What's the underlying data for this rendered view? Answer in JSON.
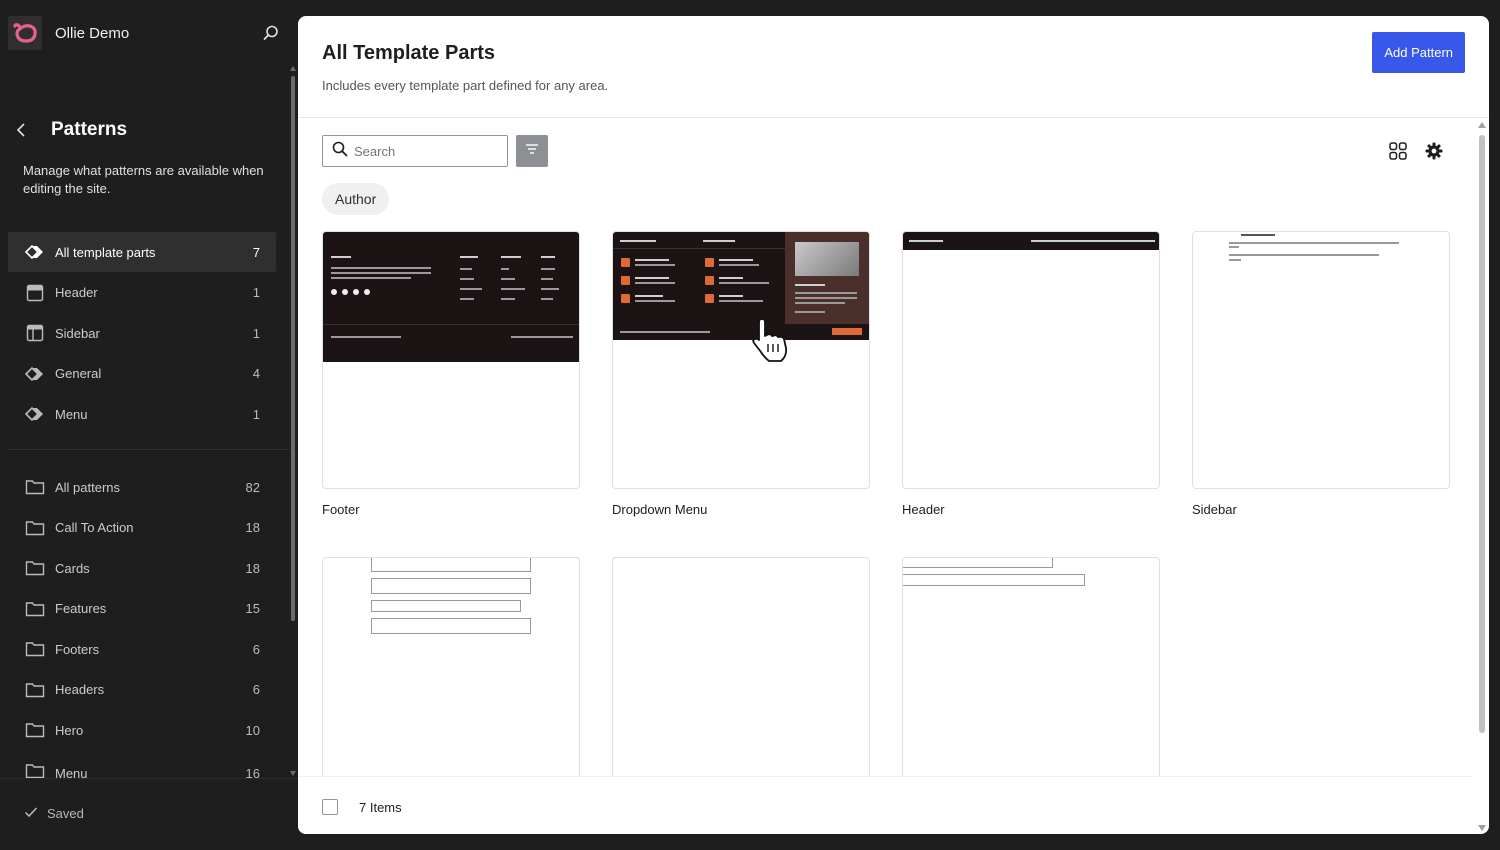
{
  "site": {
    "title": "Ollie Demo"
  },
  "nav": {
    "title": "Patterns",
    "description": "Manage what patterns are available when editing the site."
  },
  "template_parts": [
    {
      "label": "All template parts",
      "count": "7",
      "icon": "diamond-icon"
    },
    {
      "label": "Header",
      "count": "1",
      "icon": "header-layout-icon"
    },
    {
      "label": "Sidebar",
      "count": "1",
      "icon": "sidebar-layout-icon"
    },
    {
      "label": "General",
      "count": "4",
      "icon": "diamond-icon"
    },
    {
      "label": "Menu",
      "count": "1",
      "icon": "diamond-icon"
    }
  ],
  "categories": [
    {
      "label": "All patterns",
      "count": "82"
    },
    {
      "label": "Call To Action",
      "count": "18"
    },
    {
      "label": "Cards",
      "count": "18"
    },
    {
      "label": "Features",
      "count": "15"
    },
    {
      "label": "Footers",
      "count": "6"
    },
    {
      "label": "Headers",
      "count": "6"
    },
    {
      "label": "Hero",
      "count": "10"
    },
    {
      "label": "Menu",
      "count": "16"
    }
  ],
  "status": {
    "saved": "Saved"
  },
  "main": {
    "title": "All Template Parts",
    "description": "Includes every template part defined for any area.",
    "add_button": "Add Pattern",
    "search_placeholder": "Search",
    "filter_chip": "Author",
    "items_count": "7 Items"
  },
  "cards": [
    {
      "name": "Footer"
    },
    {
      "name": "Dropdown Menu"
    },
    {
      "name": "Header"
    },
    {
      "name": "Sidebar"
    },
    {
      "name": ""
    },
    {
      "name": ""
    },
    {
      "name": ""
    }
  ],
  "colors": {
    "accent": "#3858e9",
    "logo": "#e8618c",
    "dark_preview": "#1c1414",
    "orange": "#e06a35"
  }
}
